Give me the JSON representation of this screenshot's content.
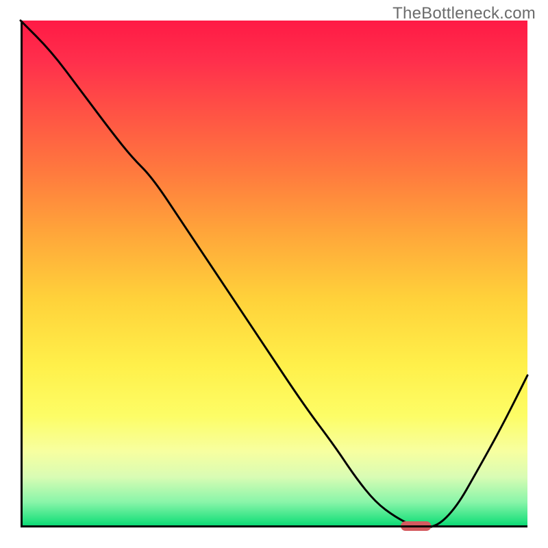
{
  "watermark": "TheBottleneck.com",
  "chart_data": {
    "type": "line",
    "title": "",
    "xlabel": "",
    "ylabel": "",
    "xlim": [
      0,
      100
    ],
    "ylim": [
      0,
      100
    ],
    "x": [
      0,
      6,
      12,
      18,
      22,
      26,
      32,
      40,
      48,
      56,
      62,
      66,
      70,
      74,
      78,
      82,
      86,
      90,
      95,
      100
    ],
    "values": [
      100,
      94,
      86,
      78,
      73,
      69,
      60,
      48,
      36,
      24,
      16,
      10,
      5,
      2,
      0,
      0,
      4,
      11,
      20,
      30
    ],
    "marker": {
      "x": 78,
      "y": 0,
      "width": 6,
      "height": 2
    },
    "gradient_note": "vertical red→yellow→green background"
  }
}
